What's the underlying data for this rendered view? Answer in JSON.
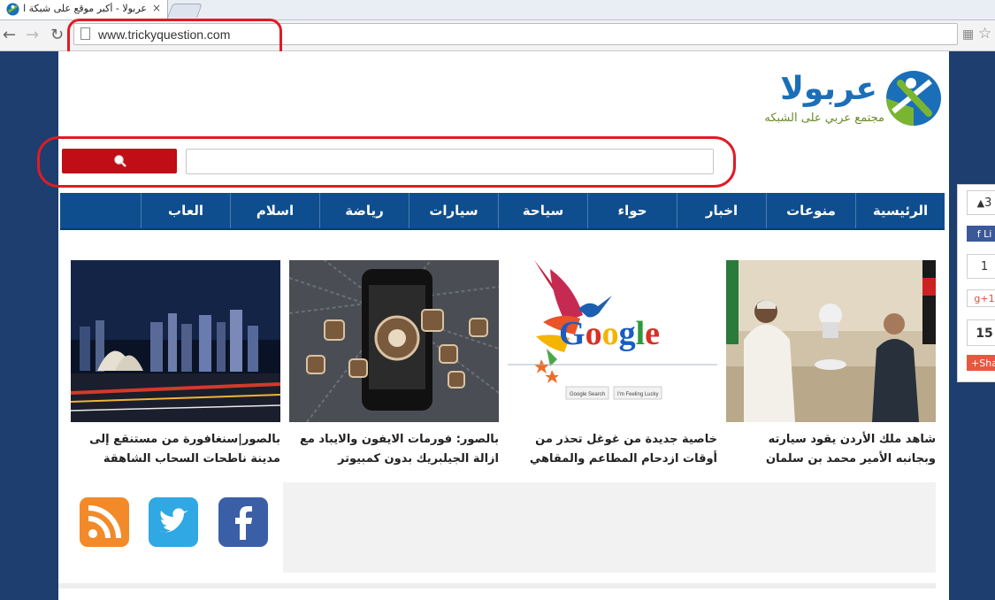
{
  "browser": {
    "tab_title": "عربولا - أكبر موقع على شبكة الا",
    "tab_close": "×",
    "url": "www.trickyquestion.com"
  },
  "site": {
    "logo_name": "عربولا",
    "logo_tagline": "مجتمع عربي على الشبكه",
    "search": {
      "placeholder": ""
    },
    "nav": [
      "الرئيسية",
      "منوعات",
      "اخبار",
      "حواء",
      "سياحة",
      "سيارات",
      "رياضة",
      "اسلام",
      "العاب"
    ],
    "articles": [
      {
        "title": "شاهد ملك الأردن يقود سيارته وبجانبه الأمير محمد بن سلمان",
        "image": "meeting-photo"
      },
      {
        "title": "خاصية جديدة من غوغل تحذر من أوقات ازدحام المطاعم والمقاهي",
        "image": "google-logo"
      },
      {
        "title": "بالصور: فورمات الايفون والايباد مع ازالة الجيلبريك بدون كمبيوتر",
        "image": "iphone-apps"
      },
      {
        "title": "بالصور|سنغافورة من مستنقع إلى مدينة ناطحات السحاب الشاهقة",
        "image": "city-night"
      }
    ],
    "google_image": {
      "logo_text": "Google",
      "btn1": "Google Search",
      "btn2": "I'm Feeling Lucky"
    },
    "social": [
      "rss-icon",
      "twitter-icon",
      "facebook-icon"
    ]
  },
  "share_widget": {
    "fb_count": "3",
    "fb_label": "Li",
    "gplus_count": "1",
    "gplus_label": "g+1",
    "share_count": "15",
    "share_label": "Sha"
  },
  "colors": {
    "nav_bg": "#0f4e8e",
    "search_button": "#c00d16",
    "annotation": "#e01b24"
  }
}
